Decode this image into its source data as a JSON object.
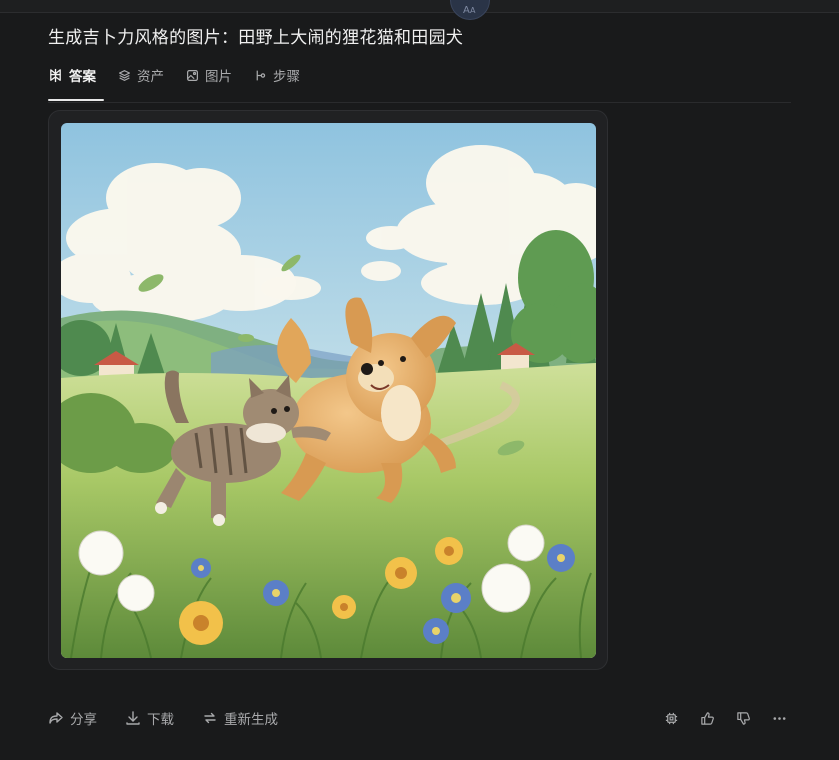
{
  "title": "生成吉卜力风格的图片：田野上大闹的狸花猫和田园犬",
  "tabs": [
    {
      "label": "答案",
      "icon": "perplexity-icon",
      "active": true
    },
    {
      "label": "资产",
      "icon": "layers-icon",
      "active": false
    },
    {
      "label": "图片",
      "icon": "image-icon",
      "active": false
    },
    {
      "label": "步骤",
      "icon": "steps-icon",
      "active": false
    }
  ],
  "actions": {
    "share_label": "分享",
    "download_label": "下载",
    "regenerate_label": "重新生成"
  },
  "right_icons": [
    "chip-icon",
    "thumbs-up-icon",
    "thumbs-down-icon",
    "more-icon"
  ],
  "colors": {
    "background": "#191a1b",
    "card": "#202123",
    "text_primary": "#f0f0f0",
    "text_secondary": "#a9aaac"
  }
}
